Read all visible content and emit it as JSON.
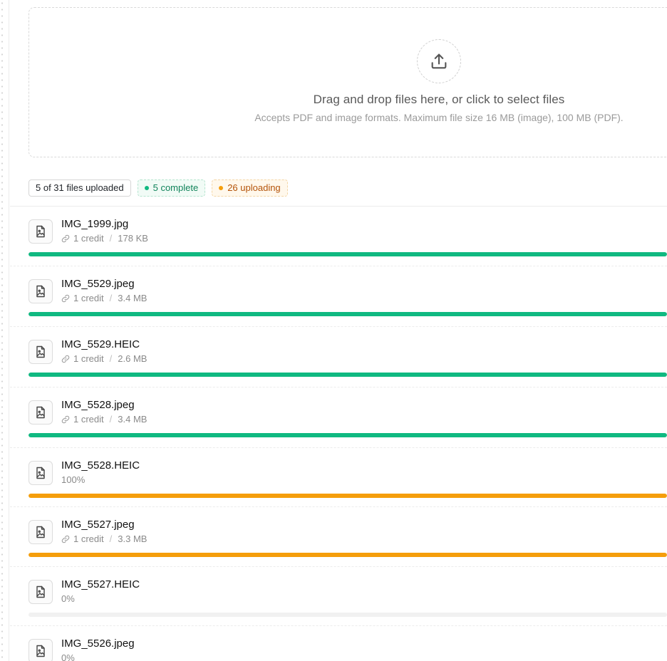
{
  "dropzone": {
    "title": "Drag and drop files here, or click to select files",
    "subtitle": "Accepts PDF and image formats. Maximum file size 16 MB (image), 100 MB (PDF).",
    "icon": "upload-icon"
  },
  "summary": {
    "total_label": "5 of 31 files uploaded",
    "complete_label": "5 complete",
    "uploading_label": "26 uploading"
  },
  "colors": {
    "complete": "#10b981",
    "uploading": "#f59e0b",
    "track": "#f1f1f1"
  },
  "files": [
    {
      "name": "IMG_1999.jpg",
      "status": "complete",
      "credit": "1 credit",
      "size": "178 KB",
      "progress": 1.0
    },
    {
      "name": "IMG_5529.jpeg",
      "status": "complete",
      "credit": "1 credit",
      "size": "3.4 MB",
      "progress": 1.0
    },
    {
      "name": "IMG_5529.HEIC",
      "status": "complete",
      "credit": "1 credit",
      "size": "2.6 MB",
      "progress": 1.0
    },
    {
      "name": "IMG_5528.jpeg",
      "status": "complete",
      "credit": "1 credit",
      "size": "3.4 MB",
      "progress": 1.0
    },
    {
      "name": "IMG_5528.HEIC",
      "status": "uploading",
      "percent": "100%",
      "progress": 1.0
    },
    {
      "name": "IMG_5527.jpeg",
      "status": "uploading",
      "credit": "1 credit",
      "size": "3.3 MB",
      "progress": 1.0
    },
    {
      "name": "IMG_5527.HEIC",
      "status": "uploading",
      "percent": "0%",
      "progress": 0.0
    },
    {
      "name": "IMG_5526.jpeg",
      "status": "uploading",
      "percent": "0%",
      "progress": 0.0
    }
  ]
}
